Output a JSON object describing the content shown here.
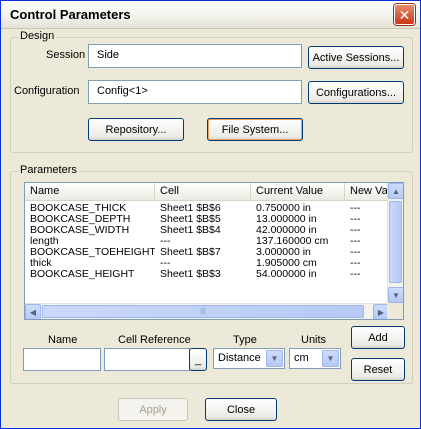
{
  "window": {
    "title": "Control Parameters",
    "close_glyph": "✕"
  },
  "design": {
    "group_label": "Design",
    "session_label": "Session",
    "session_value": "Side",
    "active_sessions_button": "Active Sessions...",
    "configuration_label": "Configuration",
    "configuration_value": "Config<1>",
    "configurations_button": "Configurations...",
    "repository_button": "Repository...",
    "file_system_button": "File System..."
  },
  "parameters": {
    "group_label": "Parameters",
    "columns": [
      "Name",
      "Cell",
      "Current Value",
      "New Va"
    ],
    "rows": [
      [
        "BOOKCASE_THICK",
        "Sheet1 $B$6",
        "0.750000 in",
        "---"
      ],
      [
        "BOOKCASE_DEPTH",
        "Sheet1 $B$5",
        "13.000000 in",
        "---"
      ],
      [
        "BOOKCASE_WIDTH",
        "Sheet1 $B$4",
        "42.000000 in",
        "---"
      ],
      [
        "length",
        "---",
        "137.160000 cm",
        "---"
      ],
      [
        "BOOKCASE_TOEHEIGHT",
        "Sheet1 $B$7",
        "3.000000 in",
        "---"
      ],
      [
        "thick",
        "---",
        "1.905000 cm",
        "---"
      ],
      [
        "BOOKCASE_HEIGHT",
        "Sheet1 $B$3",
        "54.000000 in",
        "---"
      ]
    ],
    "name_label": "Name",
    "cell_reference_label": "Cell Reference",
    "type_label": "Type",
    "units_label": "Units",
    "name_value": "",
    "cell_reference_value": "",
    "cell_ref_browse": "_",
    "type_value": "Distance",
    "units_value": "cm",
    "add_button": "Add",
    "reset_button": "Reset"
  },
  "footer": {
    "apply_button": "Apply",
    "close_button": "Close"
  },
  "icons": {
    "scroll_up": "▲",
    "scroll_down": "▼",
    "scroll_left": "◀",
    "scroll_right": "▶",
    "dropdown": "▼",
    "grip": "|||"
  }
}
